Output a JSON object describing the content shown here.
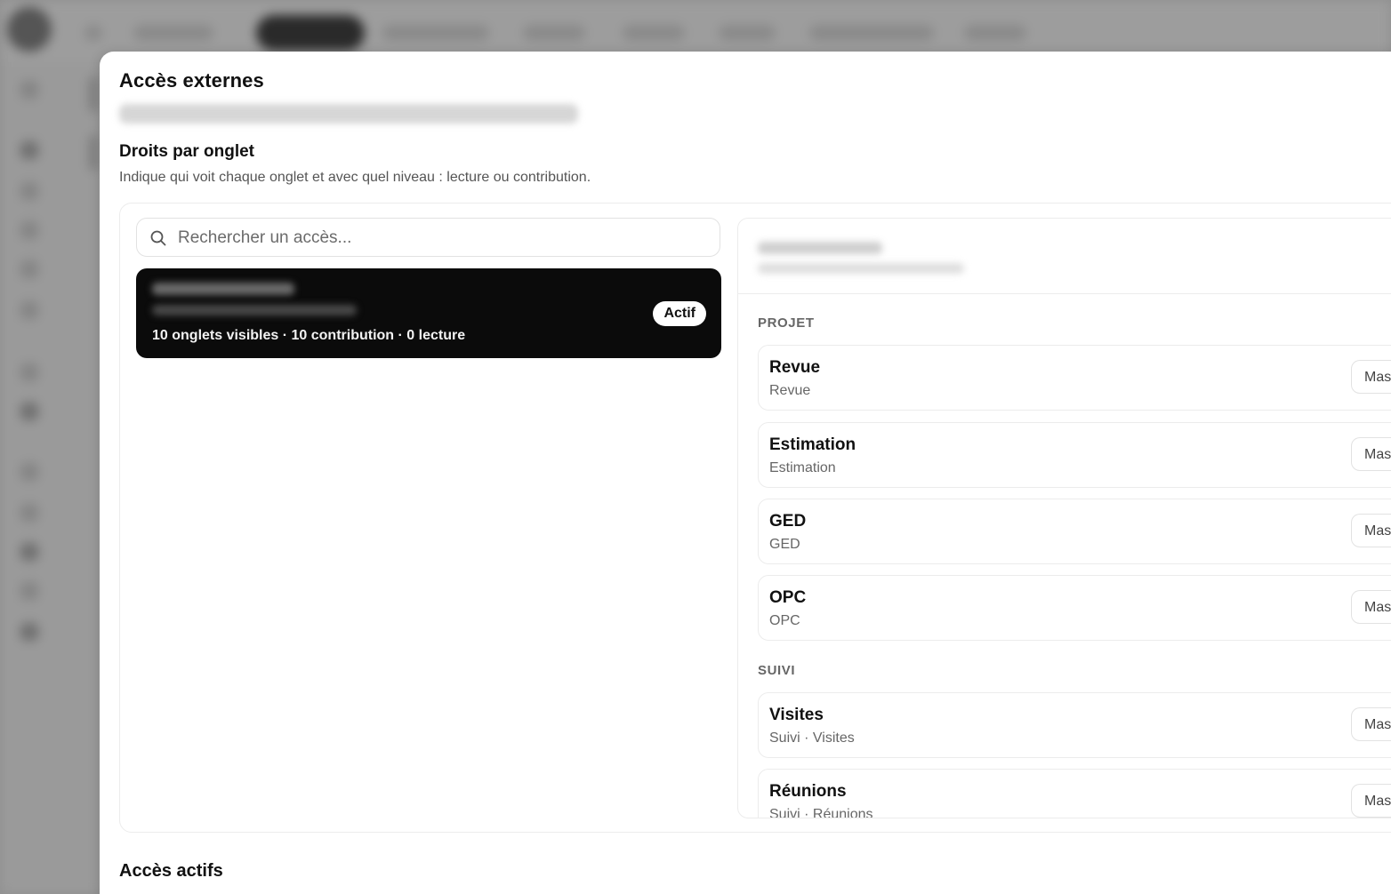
{
  "modal": {
    "title": "Accès externes"
  },
  "rights_section": {
    "title": "Droits par onglet",
    "description": "Indique qui voit chaque onglet et avec quel niveau : lecture ou contribution."
  },
  "search": {
    "placeholder": "Rechercher un accès..."
  },
  "access_list": [
    {
      "stats": "10 onglets visibles · 10 contribution · 0 lecture",
      "status": "Actif",
      "selected": true
    }
  ],
  "groups": [
    {
      "label": "PROJET",
      "rows": [
        {
          "title": "Revue",
          "subtitle": "Revue",
          "level": "Mas"
        },
        {
          "title": "Estimation",
          "subtitle": "Estimation",
          "level": "Mas"
        },
        {
          "title": "GED",
          "subtitle": "GED",
          "level": "Mas"
        },
        {
          "title": "OPC",
          "subtitle": "OPC",
          "level": "Mas"
        }
      ]
    },
    {
      "label": "SUIVI",
      "rows": [
        {
          "title": "Visites",
          "subtitle": "Suivi · Visites",
          "level": "Mas"
        },
        {
          "title": "Réunions",
          "subtitle": "Suivi · Réunions",
          "level": "Mas"
        }
      ]
    }
  ],
  "active_section": {
    "title": "Accès actifs"
  },
  "icons": {
    "search": "search-icon"
  }
}
